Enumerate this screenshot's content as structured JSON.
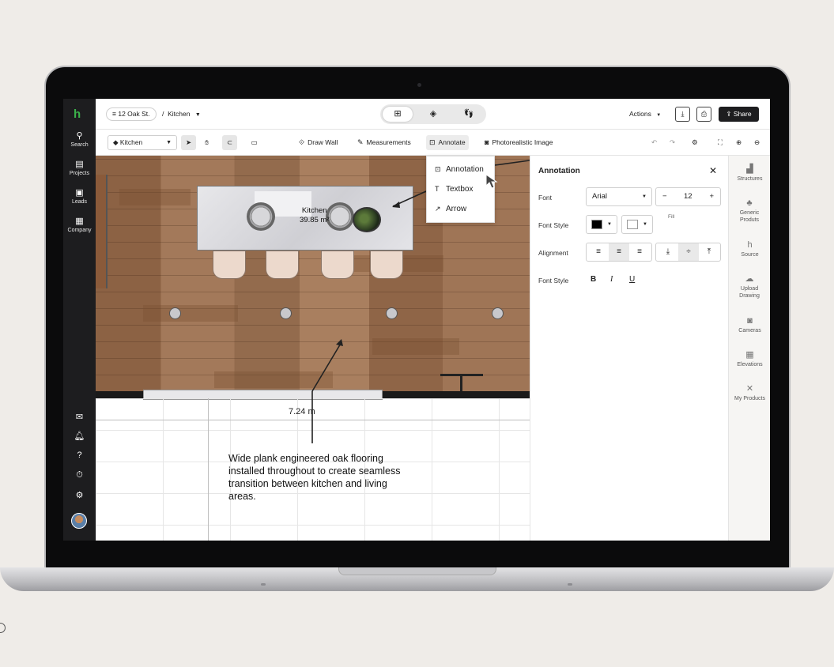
{
  "left_rail": {
    "logo": "h",
    "items": [
      {
        "icon": "search-icon",
        "glyph": "⚲",
        "label": "Search"
      },
      {
        "icon": "projects-icon",
        "glyph": "▤",
        "label": "Projects"
      },
      {
        "icon": "leads-icon",
        "glyph": "▣",
        "label": "Leads"
      },
      {
        "icon": "company-icon",
        "glyph": "▦",
        "label": "Company"
      }
    ],
    "bottom_icons": [
      "mail-icon",
      "bell-icon",
      "help-icon",
      "timer-icon",
      "settings-icon"
    ]
  },
  "header": {
    "project": "12 Oak St.",
    "project_glyph": "≡",
    "room": "Kitchen",
    "breadcrumb_sep": "/",
    "actions_label": "Actions",
    "share_label": "Share"
  },
  "toolbar": {
    "floor": "Kitchen",
    "draw_wall": "Draw Wall",
    "measurements": "Measurements",
    "annotate": "Annotate",
    "photorealistic": "Photorealistic Image"
  },
  "annotate_menu": {
    "items": [
      "Annotation",
      "Textbox",
      "Arrow"
    ]
  },
  "canvas": {
    "room_name": "Kitchen",
    "room_area": "39.85 m²",
    "dimension": "7.24 m",
    "note_text": "Wide plank engineered oak flooring installed throughout to create seamless transition between kitchen and living areas."
  },
  "panel": {
    "title": "Annotation",
    "font_label": "Font",
    "font_value": "Arial",
    "font_size": "12",
    "font_style_label": "Font Style",
    "fill_label": "Fill",
    "alignment_label": "Alignment",
    "font_style_label_2": "Font Style",
    "text_color": "#000000",
    "fill_color": "#ffffff",
    "text_style": {
      "bold": "B",
      "italic": "I",
      "underline": "U"
    }
  },
  "right_rail": {
    "items": [
      {
        "icon": "structures-icon",
        "label": "Structures"
      },
      {
        "icon": "generic-products-icon",
        "label": "Generic Produts"
      },
      {
        "icon": "source-icon",
        "label": "Source"
      },
      {
        "icon": "upload-drawing-icon",
        "label": "Upload Drawing"
      },
      {
        "icon": "cameras-icon",
        "label": "Cameras"
      },
      {
        "icon": "elevations-icon",
        "label": "Elevations"
      },
      {
        "icon": "my-products-icon",
        "label": "My Products"
      }
    ]
  },
  "colors": {
    "brand_green": "#3bb14a",
    "rail_dark": "#1d1d1f",
    "floor_wood": "#9c7152"
  }
}
